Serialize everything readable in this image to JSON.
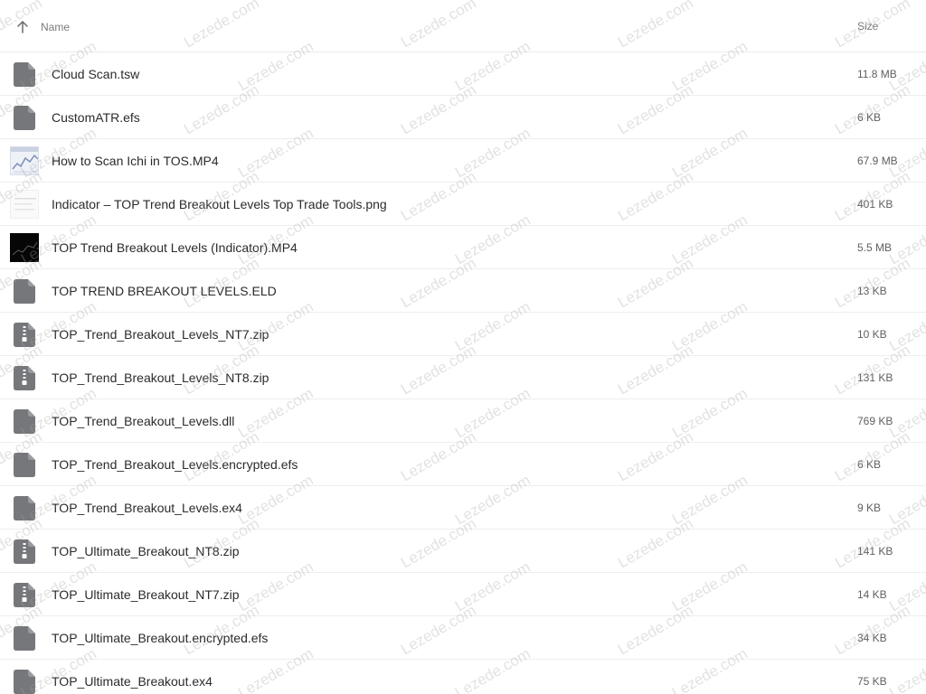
{
  "header": {
    "sort_icon": "arrow-up-icon",
    "name_label": "Name",
    "size_label": "Size"
  },
  "files": [
    {
      "name": "Cloud Scan.tsw",
      "size": "11.8 MB",
      "icon": "file-icon"
    },
    {
      "name": "CustomATR.efs",
      "size": "6 KB",
      "icon": "file-icon"
    },
    {
      "name": "How to Scan Ichi in TOS.MP4",
      "size": "67.9 MB",
      "icon": "video-thumbnail"
    },
    {
      "name": "Indicator – TOP Trend Breakout Levels Top Trade Tools.png",
      "size": "401 KB",
      "icon": "image-thumbnail"
    },
    {
      "name": "TOP Trend Breakout Levels (Indicator).MP4",
      "size": "5.5 MB",
      "icon": "video-thumbnail"
    },
    {
      "name": "TOP TREND BREAKOUT LEVELS.ELD",
      "size": "13 KB",
      "icon": "file-icon"
    },
    {
      "name": "TOP_Trend_Breakout_Levels_NT7.zip",
      "size": "10 KB",
      "icon": "zip-icon"
    },
    {
      "name": "TOP_Trend_Breakout_Levels_NT8.zip",
      "size": "131 KB",
      "icon": "zip-icon"
    },
    {
      "name": "TOP_Trend_Breakout_Levels.dll",
      "size": "769 KB",
      "icon": "file-icon"
    },
    {
      "name": "TOP_Trend_Breakout_Levels.encrypted.efs",
      "size": "6 KB",
      "icon": "file-icon"
    },
    {
      "name": "TOP_Trend_Breakout_Levels.ex4",
      "size": "9 KB",
      "icon": "file-icon"
    },
    {
      "name": "TOP_Ultimate_Breakout_NT8.zip",
      "size": "141 KB",
      "icon": "zip-icon"
    },
    {
      "name": "TOP_Ultimate_Breakout_NT7.zip",
      "size": "14 KB",
      "icon": "zip-icon"
    },
    {
      "name": "TOP_Ultimate_Breakout.encrypted.efs",
      "size": "34 KB",
      "icon": "file-icon"
    },
    {
      "name": "TOP_Ultimate_Breakout.ex4",
      "size": "75 KB",
      "icon": "file-icon"
    }
  ],
  "watermark": {
    "text": "Lezede.com"
  },
  "colors": {
    "icon_gray": "#76777a",
    "row_divider": "#eeeeee",
    "header_text": "#7a7a7a"
  }
}
